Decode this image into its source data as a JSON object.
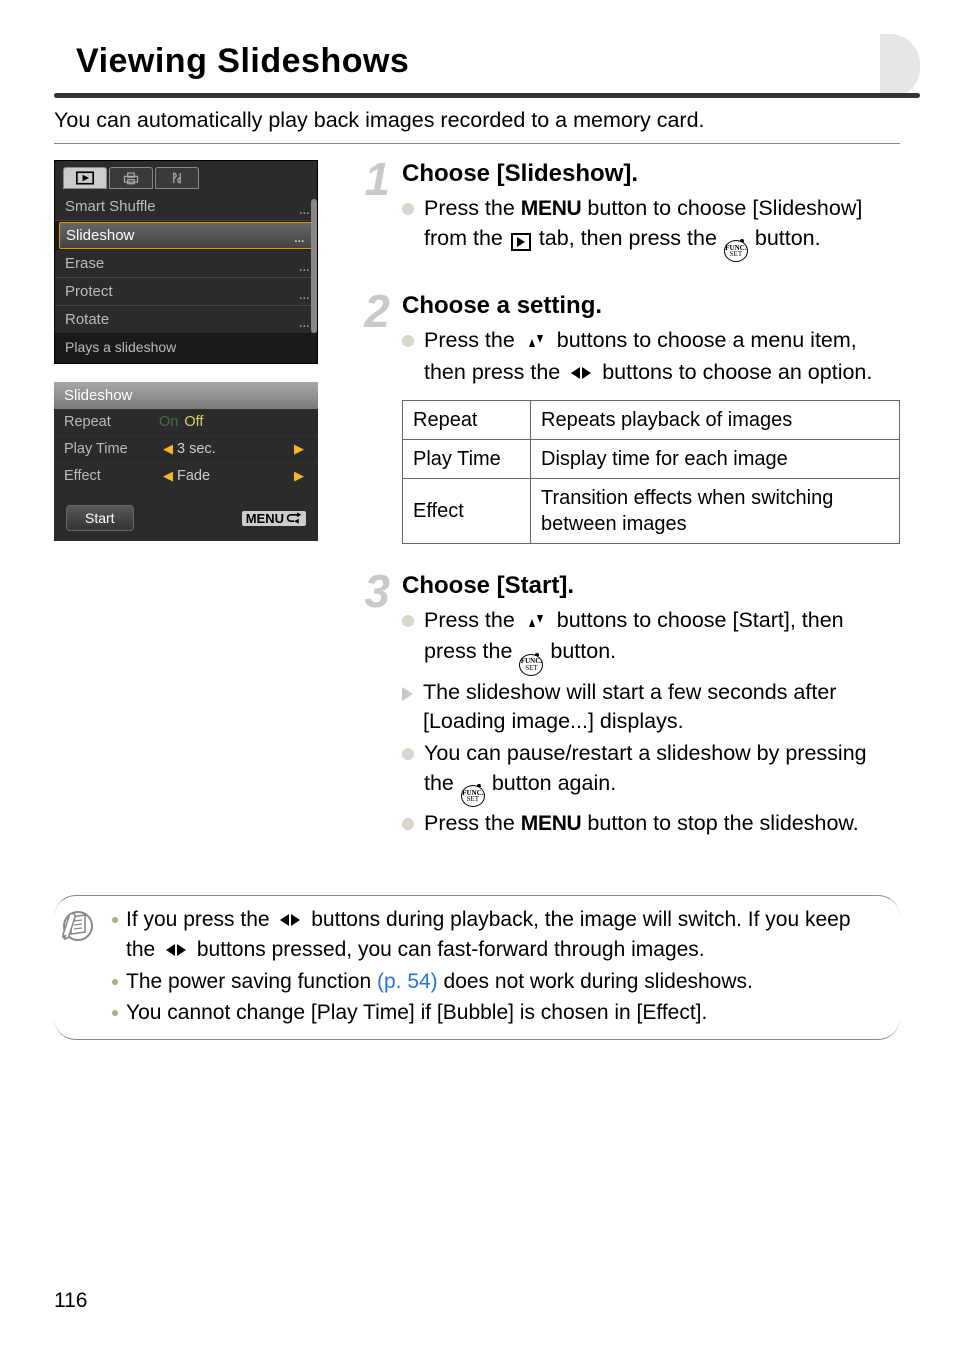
{
  "page": {
    "title": "Viewing Slideshows",
    "intro": "You can automatically play back images recorded to a memory card.",
    "number": "116"
  },
  "camera_menu": {
    "items": [
      "Smart Shuffle",
      "Slideshow",
      "Erase",
      "Protect",
      "Rotate"
    ],
    "selected_index": 1,
    "footer": "Plays a slideshow"
  },
  "slideshow_panel": {
    "title": "Slideshow",
    "rows": [
      {
        "label": "Repeat",
        "onoff": true,
        "on": "On",
        "off": "Off"
      },
      {
        "label": "Play Time",
        "value": "3 sec."
      },
      {
        "label": "Effect",
        "value": "Fade"
      }
    ],
    "start": "Start",
    "menu": "MENU"
  },
  "steps": [
    {
      "num": "1",
      "title": "Choose [Slideshow].",
      "bullets": [
        {
          "kind": "dot",
          "segments": [
            {
              "t": "Press the "
            },
            {
              "t": "MENU",
              "cls": "menu-text"
            },
            {
              "t": " button to choose [Slideshow] from the "
            },
            {
              "icon": "play-square"
            },
            {
              "t": " tab, then press the "
            },
            {
              "icon": "func"
            },
            {
              "t": " button."
            }
          ]
        }
      ]
    },
    {
      "num": "2",
      "title": "Choose a setting.",
      "bullets": [
        {
          "kind": "dot",
          "segments": [
            {
              "t": "Press the "
            },
            {
              "icon": "ud"
            },
            {
              "t": " buttons to choose a menu item, then press the "
            },
            {
              "icon": "lr"
            },
            {
              "t": " buttons to choose an option."
            }
          ]
        }
      ],
      "table": [
        {
          "k": "Repeat",
          "v": "Repeats playback of images"
        },
        {
          "k": "Play Time",
          "v": "Display time for each image"
        },
        {
          "k": "Effect",
          "v": "Transition effects when switching between images"
        }
      ]
    },
    {
      "num": "3",
      "title": "Choose [Start].",
      "bullets": [
        {
          "kind": "dot",
          "segments": [
            {
              "t": "Press the "
            },
            {
              "icon": "ud"
            },
            {
              "t": " buttons to choose [Start], then press the "
            },
            {
              "icon": "func"
            },
            {
              "t": " button."
            }
          ]
        },
        {
          "kind": "arrow",
          "segments": [
            {
              "t": "The slideshow will start a few seconds after [Loading image...] displays."
            }
          ]
        },
        {
          "kind": "dot",
          "segments": [
            {
              "t": "You can pause/restart a slideshow by pressing the "
            },
            {
              "icon": "func"
            },
            {
              "t": " button again."
            }
          ]
        },
        {
          "kind": "dot",
          "segments": [
            {
              "t": "Press the "
            },
            {
              "t": "MENU",
              "cls": "menu-text"
            },
            {
              "t": " button to stop the slideshow."
            }
          ]
        }
      ]
    }
  ],
  "notes": [
    {
      "segments": [
        {
          "t": "If you press the "
        },
        {
          "icon": "lr"
        },
        {
          "t": " buttons during playback, the image will switch. If you keep the "
        },
        {
          "icon": "lr"
        },
        {
          "t": " buttons pressed, you can fast-forward through images."
        }
      ]
    },
    {
      "segments": [
        {
          "t": "The power saving function "
        },
        {
          "t": "(p. 54)",
          "cls": "pageref"
        },
        {
          "t": " does not work during slideshows."
        }
      ]
    },
    {
      "segments": [
        {
          "t": "You cannot change [Play Time] if [Bubble] is chosen in [Effect]."
        }
      ]
    }
  ]
}
